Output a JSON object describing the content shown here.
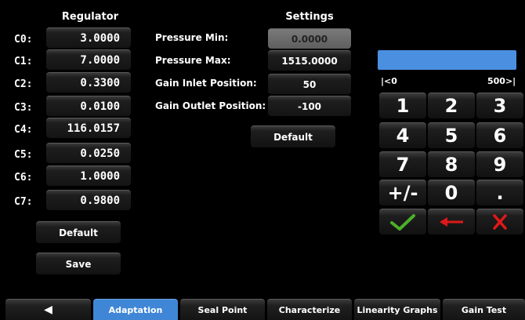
{
  "regulator": {
    "title": "Regulator",
    "coefficients": [
      {
        "label": "C0:",
        "value": "3.0000"
      },
      {
        "label": "C1:",
        "value": "7.0000"
      },
      {
        "label": "C2:",
        "value": "0.3300"
      },
      {
        "label": "C3:",
        "value": "0.0100"
      },
      {
        "label": "C4:",
        "value": "116.0157"
      },
      {
        "label": "C5:",
        "value": "0.0250"
      },
      {
        "label": "C6:",
        "value": "1.0000"
      },
      {
        "label": "C7:",
        "value": "0.9800"
      }
    ],
    "default_label": "Default",
    "save_label": "Save"
  },
  "settings": {
    "title": "Settings",
    "pressure_min": {
      "label": "Pressure Min:",
      "value": "0.0000"
    },
    "pressure_max": {
      "label": "Pressure Max:",
      "value": "1515.0000"
    },
    "gain_inlet": {
      "label": "Gain Inlet Position:",
      "value": "50"
    },
    "gain_outlet": {
      "label": "Gain Outlet Position:",
      "value": "-100"
    },
    "default_label": "Default"
  },
  "keypad": {
    "entry_value": "",
    "range_min": "|<0",
    "range_max": "500>|",
    "keys": [
      "1",
      "2",
      "3",
      "4",
      "5",
      "6",
      "7",
      "8",
      "9",
      "+/-",
      "0",
      "."
    ],
    "accent": "#4a8fe0"
  },
  "tabs": [
    {
      "label": "◀",
      "icon": "back-arrow-icon"
    },
    {
      "label": "Adaptation",
      "active": true
    },
    {
      "label": "Seal Point"
    },
    {
      "label": "Characterize"
    },
    {
      "label": "Linearity Graphs"
    },
    {
      "label": "Gain Test"
    }
  ],
  "colors": {
    "tab_active": "#3f86d6",
    "confirm": "#4caf2a",
    "backspace": "#e01818",
    "cancel": "#e01818"
  }
}
